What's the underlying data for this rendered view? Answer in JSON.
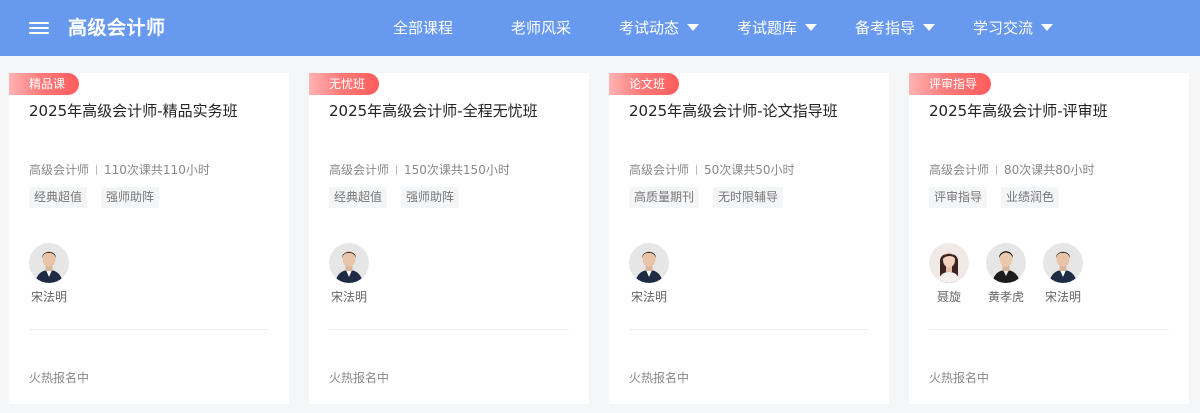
{
  "header": {
    "brand": "高级会计师",
    "nav": [
      {
        "label": "全部课程",
        "dropdown": false
      },
      {
        "label": "老师风采",
        "dropdown": false
      },
      {
        "label": "考试动态",
        "dropdown": true
      },
      {
        "label": "考试题库",
        "dropdown": true
      },
      {
        "label": "备考指导",
        "dropdown": true
      },
      {
        "label": "学习交流",
        "dropdown": true
      }
    ]
  },
  "colors": {
    "header_bg": "#6799ee",
    "badge_gradient": [
      "#ffb3b3",
      "#ff5c5c"
    ],
    "page_bg": "#f5f6f8"
  },
  "cards": [
    {
      "badge": "精品课",
      "title": "2025年高级会计师-精品实务班",
      "category": "高级会计师",
      "lessons": "110次课共110小时",
      "tags": [
        "经典超值",
        "强师助阵"
      ],
      "teachers": [
        {
          "name": "宋法明",
          "avatar": "male-teacher-avatar"
        }
      ],
      "status": "火热报名中"
    },
    {
      "badge": "无忧班",
      "title": "2025年高级会计师-全程无忧班",
      "category": "高级会计师",
      "lessons": "150次课共150小时",
      "tags": [
        "经典超值",
        "强师助阵"
      ],
      "teachers": [
        {
          "name": "宋法明",
          "avatar": "male-teacher-avatar"
        }
      ],
      "status": "火热报名中"
    },
    {
      "badge": "论文班",
      "title": "2025年高级会计师-论文指导班",
      "category": "高级会计师",
      "lessons": "50次课共50小时",
      "tags": [
        "高质量期刊",
        "无时限辅导"
      ],
      "teachers": [
        {
          "name": "宋法明",
          "avatar": "male-teacher-avatar"
        }
      ],
      "status": "火热报名中"
    },
    {
      "badge": "评审指导",
      "title": "2025年高级会计师-评审班",
      "category": "高级会计师",
      "lessons": "80次课共80小时",
      "tags": [
        "评审指导",
        "业绩润色"
      ],
      "teachers": [
        {
          "name": "聂旋",
          "avatar": "female-teacher-avatar"
        },
        {
          "name": "黄孝虎",
          "avatar": "male-teacher-avatar"
        },
        {
          "name": "宋法明",
          "avatar": "male-teacher-avatar"
        }
      ],
      "status": "火热报名中"
    }
  ]
}
